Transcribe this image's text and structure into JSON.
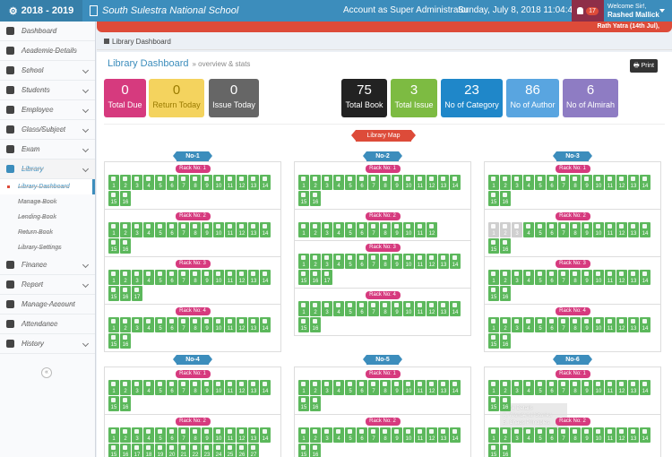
{
  "topbar": {
    "year": "2018 - 2019",
    "school_name": "South Sulestra National School",
    "account": "Account as Super Administrator",
    "datetime": "Sunday, July 8, 2018 11:04:47 PM",
    "notifications": "17",
    "welcome": "Welcome Sir!,",
    "user_name": "Rashed Mallick"
  },
  "marquee": "Rath Yatra (14th Jul),",
  "breadcrumb": "Library Dashboard",
  "page": {
    "title": "Library Dashboard",
    "subtitle": "» overview & stats",
    "print": "Print"
  },
  "sidebar": {
    "items": [
      {
        "label": "Dashboard",
        "chev": false
      },
      {
        "label": "Academic Details",
        "chev": false
      },
      {
        "label": "School",
        "chev": true
      },
      {
        "label": "Students",
        "chev": true
      },
      {
        "label": "Employee",
        "chev": true
      },
      {
        "label": "Class/Subject",
        "chev": true
      },
      {
        "label": "Exam",
        "chev": true
      },
      {
        "label": "Library",
        "chev": true
      }
    ],
    "sub_items": [
      "Library Dashboard",
      "Manage Book",
      "Lending Book",
      "Return Book",
      "Library Settings"
    ],
    "items_after": [
      {
        "label": "Finance",
        "chev": true
      },
      {
        "label": "Report",
        "chev": true
      },
      {
        "label": "Manage Account",
        "chev": false
      },
      {
        "label": "Attendance",
        "chev": false
      },
      {
        "label": "History",
        "chev": true
      }
    ]
  },
  "cards": [
    {
      "value": "0",
      "label": "Total Due",
      "color": "#d63a7e"
    },
    {
      "value": "0",
      "label": "Return Today",
      "color": "#f4d35e"
    },
    {
      "value": "0",
      "label": "Issue Today",
      "color": "#666666"
    },
    {
      "value": "75",
      "label": "Total Book",
      "color": "#222222"
    },
    {
      "value": "3",
      "label": "Total Issue",
      "color": "#7dbb42"
    },
    {
      "value": "23",
      "label": "No of Category",
      "color": "#1f87c9"
    },
    {
      "value": "86",
      "label": "No of Author",
      "color": "#59a5e0"
    },
    {
      "value": "6",
      "label": "No of Almirah",
      "color": "#8e7cc3"
    }
  ],
  "library_map": "Library Map",
  "almirahs": [
    {
      "name": "No-1",
      "racks": [
        {
          "name": "Rack No: 1",
          "books": 16,
          "gray": 0
        },
        {
          "name": "Rack No: 2",
          "books": 16,
          "gray": 0
        },
        {
          "name": "Rack No: 3",
          "books": 17,
          "gray": 0
        },
        {
          "name": "Rack No: 4",
          "books": 16,
          "gray": 0
        }
      ]
    },
    {
      "name": "No-2",
      "racks": [
        {
          "name": "Rack No: 1",
          "books": 16,
          "gray": 0
        },
        {
          "name": "Rack No: 2",
          "books": 12,
          "gray": 0
        },
        {
          "name": "Rack No: 3",
          "books": 17,
          "gray": 0
        },
        {
          "name": "Rack No: 4",
          "books": 16,
          "gray": 0
        }
      ]
    },
    {
      "name": "No-3",
      "racks": [
        {
          "name": "Rack No: 1",
          "books": 16,
          "gray": 0
        },
        {
          "name": "Rack No: 2",
          "books": 13,
          "gray": 3
        },
        {
          "name": "Rack No: 3",
          "books": 16,
          "gray": 0
        },
        {
          "name": "Rack No: 4",
          "books": 16,
          "gray": 0
        }
      ]
    },
    {
      "name": "No-4",
      "racks": [
        {
          "name": "Rack No: 1",
          "books": 16,
          "gray": 0
        },
        {
          "name": "Rack No: 2",
          "books": 27,
          "gray": 0
        }
      ]
    },
    {
      "name": "No-5",
      "racks": [
        {
          "name": "Rack No: 1",
          "books": 16,
          "gray": 0
        },
        {
          "name": "Rack No: 2",
          "books": 16,
          "gray": 0
        },
        {
          "name": "Rack No: 3",
          "books": 0,
          "gray": 0
        }
      ]
    },
    {
      "name": "No-6",
      "racks": [
        {
          "name": "Rack No: 1",
          "books": 16,
          "gray": 0
        },
        {
          "name": "Rack No: 2",
          "books": 16,
          "gray": 0
        },
        {
          "name": "Rack No: 3",
          "books": 0,
          "gray": 0
        }
      ]
    }
  ],
  "tooltip": [
    "Book Details",
    "A. Wonderful Stories",
    "B. Chaos Principles"
  ]
}
